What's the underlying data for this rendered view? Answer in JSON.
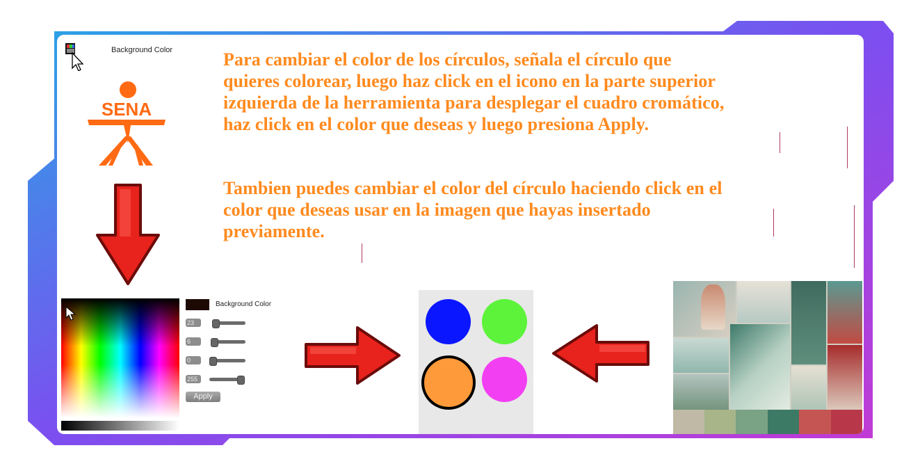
{
  "top_tool": {
    "background_color_label": "Background Color"
  },
  "instructions": {
    "paragraph1_lines": [
      "Para cambiar el color de los círculos, señala el círculo que",
      "quieres colorear, luego haz click en el icono en la parte superior",
      "izquierda de la herramienta para desplegar el cuadro cromático,",
      "haz click en el color que deseas y luego presiona Apply."
    ],
    "paragraph2_lines": [
      "Tambien puedes cambiar el color del círculo haciendo click en el",
      "color que deseas usar en la imagen que hayas insertado",
      "previamente."
    ]
  },
  "logo": {
    "text": "SENA",
    "color": "#ff6a13"
  },
  "color_picker": {
    "background_color_label": "Background Color",
    "swatch_color": "#1e0a04",
    "sliders": [
      {
        "value": "23",
        "fraction": 0.09
      },
      {
        "value": "6",
        "fraction": 0.02
      },
      {
        "value": "0",
        "fraction": 0.0
      },
      {
        "value": "255",
        "fraction": 1.0
      }
    ],
    "apply_label": "Apply"
  },
  "circles": [
    {
      "name": "circle-blue",
      "color": "#0a16ff"
    },
    {
      "name": "circle-green",
      "color": "#5cf33a"
    },
    {
      "name": "circle-orange-selected",
      "color": "#ff9a3a",
      "selected": true
    },
    {
      "name": "circle-magenta",
      "color": "#f23ff2"
    }
  ],
  "moodboard_palette": [
    "#bfb9a5",
    "#a7b589",
    "#7aa284",
    "#3d7a66",
    "#c45553",
    "#b8384a"
  ],
  "arrow_color": "#e8221c",
  "accent_frame_gradient": [
    "#1aa7e8",
    "#7a3df0",
    "#c23bd8"
  ]
}
